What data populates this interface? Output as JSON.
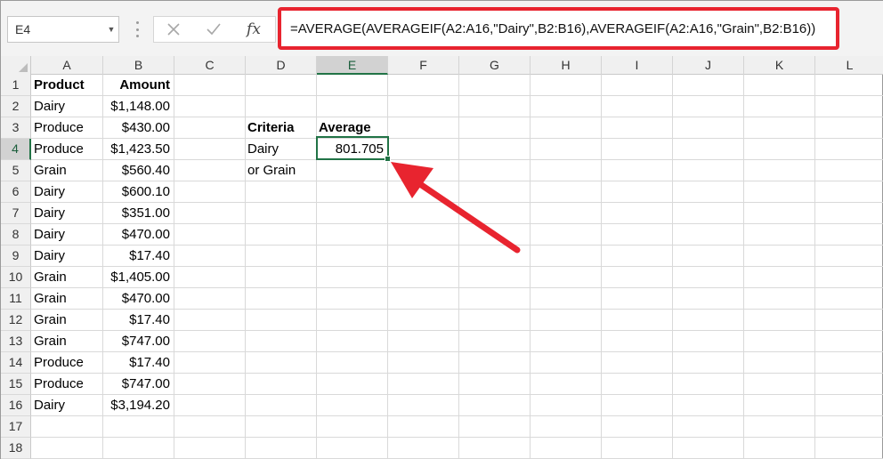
{
  "name_box": {
    "value": "E4"
  },
  "formula_bar": {
    "formula": "=AVERAGE(AVERAGEIF(A2:A16,\"Dairy\",B2:B16),AVERAGEIF(A2:A16,\"Grain\",B2:B16))",
    "fx_label": "fx"
  },
  "columns": [
    "A",
    "B",
    "C",
    "D",
    "E",
    "F",
    "G",
    "H",
    "I",
    "J",
    "K",
    "L"
  ],
  "rows": [
    "1",
    "2",
    "3",
    "4",
    "5",
    "6",
    "7",
    "8",
    "9",
    "10",
    "11",
    "12",
    "13",
    "14",
    "15",
    "16",
    "17",
    "18"
  ],
  "selected_cell": {
    "column": "E",
    "row": "4"
  },
  "sheet": {
    "header": {
      "product": "Product",
      "amount": "Amount"
    },
    "data": [
      {
        "product": "Dairy",
        "amount": "$1,148.00"
      },
      {
        "product": "Produce",
        "amount": "$430.00"
      },
      {
        "product": "Produce",
        "amount": "$1,423.50"
      },
      {
        "product": "Grain",
        "amount": "$560.40"
      },
      {
        "product": "Dairy",
        "amount": "$600.10"
      },
      {
        "product": "Dairy",
        "amount": "$351.00"
      },
      {
        "product": "Dairy",
        "amount": "$470.00"
      },
      {
        "product": "Dairy",
        "amount": "$17.40"
      },
      {
        "product": "Grain",
        "amount": "$1,405.00"
      },
      {
        "product": "Grain",
        "amount": "$470.00"
      },
      {
        "product": "Grain",
        "amount": "$17.40"
      },
      {
        "product": "Grain",
        "amount": "$747.00"
      },
      {
        "product": "Produce",
        "amount": "$17.40"
      },
      {
        "product": "Produce",
        "amount": "$747.00"
      },
      {
        "product": "Dairy",
        "amount": "$3,194.20"
      }
    ],
    "criteria_header": "Criteria",
    "average_header": "Average",
    "criteria_line1": "Dairy",
    "criteria_line2": "or Grain",
    "average_value": "801.705"
  },
  "colors": {
    "highlight_red": "#e8242f",
    "excel_green": "#217346",
    "header_gray": "#f0f0f0"
  },
  "icons": {
    "cancel": "close-icon",
    "enter": "checkmark-icon",
    "function": "fx-icon",
    "name_box_dropdown": "chevron-down-icon"
  }
}
